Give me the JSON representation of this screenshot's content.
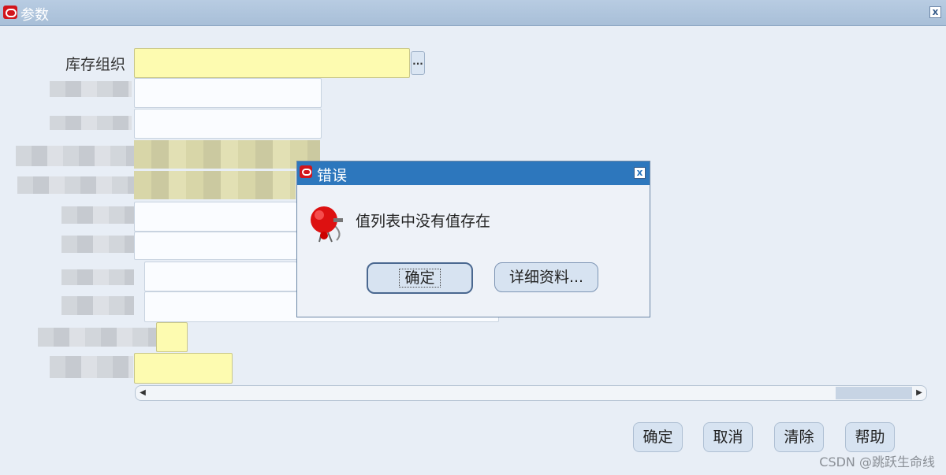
{
  "window": {
    "title": "参数",
    "close_glyph": "x"
  },
  "form": {
    "inventory_org_label": "库存组织",
    "lov_glyph": "..."
  },
  "scrollbar": {
    "left_arrow": "◀",
    "right_arrow": "▶"
  },
  "buttons": {
    "ok": "确定",
    "cancel": "取消",
    "clear": "清除",
    "help": "帮助"
  },
  "error_dialog": {
    "title": "错误",
    "message": "值列表中没有值存在",
    "ok_label": "确定",
    "details_label": "详细资料...",
    "close_glyph": "x",
    "icon": "alarm-bell-icon"
  },
  "watermark": "CSDN @跳跃生命线",
  "colors": {
    "titlebar": "#a8bfd8",
    "dialog_titlebar": "#2d77bd",
    "required_field": "#fdfbb0",
    "background": "#e8eef6"
  }
}
